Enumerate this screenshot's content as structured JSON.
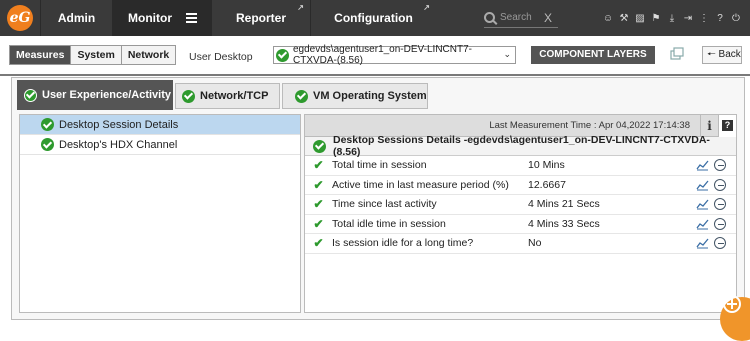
{
  "topnav": {
    "tabs": [
      {
        "label": "Admin"
      },
      {
        "label": "Monitor"
      },
      {
        "label": "Reporter"
      },
      {
        "label": "Configuration"
      }
    ],
    "search_placeholder": "Search",
    "search_clear": "X",
    "icons": [
      "user-icon",
      "link-icon",
      "zone-icon",
      "alert-icon",
      "download-icon",
      "login-icon",
      "more-icon",
      "help-icon",
      "power-icon"
    ],
    "icon_glyphs": [
      "☺",
      "⚒",
      "▨",
      "⚑",
      "⤓",
      "⇥",
      "⋮",
      "?",
      "⏻"
    ]
  },
  "subnav": {
    "segments": [
      "Measures",
      "System",
      "Network"
    ],
    "context_label": "User Desktop",
    "selected_component": "egdevds\\agentuser1_on-DEV-LINCNT7-CTXVDA-(8.56)",
    "component_layers_label": "COMPONENT LAYERS",
    "back_label": "Back"
  },
  "layer_tabs": [
    {
      "label": "User Experience/Activity"
    },
    {
      "label": "Network/TCP"
    },
    {
      "label": "VM Operating System"
    }
  ],
  "tests": [
    {
      "label": "Desktop Session Details"
    },
    {
      "label": "Desktop's HDX Channel"
    }
  ],
  "details": {
    "last_measurement": "Last Measurement Time : Apr 04,2022 17:14:38",
    "info_icon_glyph": "i",
    "help_icon_glyph": "?",
    "title": "Desktop Sessions Details -egdevds\\agentuser1_on-DEV-LINCNT7-CTXVDA-(8.56)",
    "measures": [
      {
        "name": "Total time in session",
        "value": "10 Mins"
      },
      {
        "name": "Active time in last measure period (%)",
        "value": "12.6667"
      },
      {
        "name": "Time since last activity",
        "value": "4 Mins 21 Secs"
      },
      {
        "name": "Total idle time in session",
        "value": "4 Mins 33 Secs"
      },
      {
        "name": "Is session idle for a long time?",
        "value": "No"
      }
    ]
  },
  "colors": {
    "ok_green": "#2e9a2e",
    "accent_orange": "#f07f1e",
    "selection_blue": "#bcd7ef"
  }
}
